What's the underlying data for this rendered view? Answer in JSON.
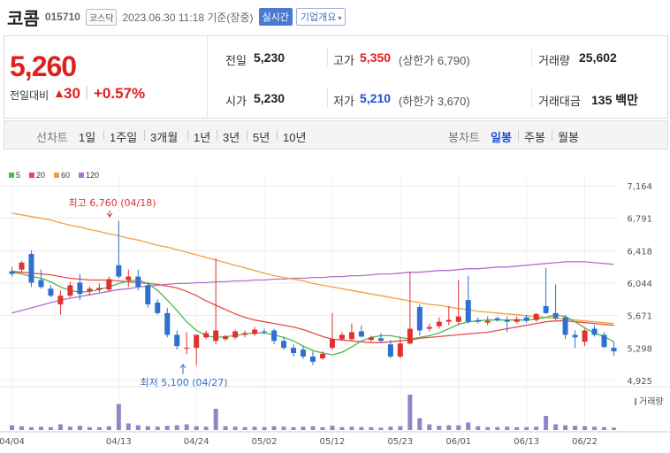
{
  "header": {
    "stock_name": "코콤",
    "stock_code": "015710",
    "market": "코스닥",
    "datetime": "2023.06.30 11:18 기준(장중)",
    "realtime_label": "실시간",
    "company_label": "기업개요"
  },
  "summary": {
    "price": "5,260",
    "change_label": "전일대비",
    "change_arrow": "▲",
    "change_value": "30",
    "change_rate": "+0.57%",
    "prev_close_label": "전일",
    "prev_close": "5,230",
    "open_label": "시가",
    "open": "5,230",
    "high_label": "고가",
    "high": "5,350",
    "upper_limit": "(상한가 6,790)",
    "low_label": "저가",
    "low": "5,210",
    "lower_limit": "(하한가 3,670)",
    "volume_label": "거래량",
    "volume": "25,602",
    "amount_label": "거래대금",
    "amount": "135 백만"
  },
  "tabs": {
    "line_label": "선차트",
    "line_periods": [
      "1일",
      "1주일",
      "3개월",
      "1년",
      "3년",
      "5년",
      "10년"
    ],
    "candle_label": "봉차트",
    "candle_periods": [
      "일봉",
      "주봉",
      "월봉"
    ],
    "active_candle": "일봉"
  },
  "colors": {
    "up": "#e03030",
    "down": "#2f6fd0",
    "ma5": "#4cb84c",
    "ma20": "#e84a4a",
    "ma60": "#f0a040",
    "ma120": "#b070d0",
    "volume": "#8e86c8"
  },
  "chart_data": {
    "type": "candlestick",
    "legend": [
      {
        "name": "5",
        "color": "#4cb84c"
      },
      {
        "name": "20",
        "color": "#e84a4a"
      },
      {
        "name": "60",
        "color": "#f0a040"
      },
      {
        "name": "120",
        "color": "#b070d0"
      }
    ],
    "y_ticks": [
      "7,164",
      "6,791",
      "6,418",
      "6,044",
      "5,671",
      "5,298",
      "4,925"
    ],
    "ylim": [
      4925,
      7164
    ],
    "x_ticks": [
      "04/04",
      "04/13",
      "04/24",
      "05/02",
      "05/12",
      "05/23",
      "06/01",
      "06/13",
      "06/22"
    ],
    "volume_label": "거래량",
    "max_annotation": "최고 6,760 (04/18)",
    "min_annotation": "최저 5,100 (04/27)",
    "candles": [
      {
        "o": 6180,
        "h": 6230,
        "l": 6120,
        "c": 6150
      },
      {
        "o": 6200,
        "h": 6300,
        "l": 6160,
        "c": 6280
      },
      {
        "o": 6380,
        "h": 6420,
        "l": 6000,
        "c": 6050
      },
      {
        "o": 6080,
        "h": 6200,
        "l": 5980,
        "c": 6000
      },
      {
        "o": 5980,
        "h": 6020,
        "l": 5880,
        "c": 5900
      },
      {
        "o": 5800,
        "h": 5960,
        "l": 5680,
        "c": 5900
      },
      {
        "o": 5900,
        "h": 6060,
        "l": 5880,
        "c": 6020
      },
      {
        "o": 6050,
        "h": 6150,
        "l": 5850,
        "c": 5920
      },
      {
        "o": 5950,
        "h": 6010,
        "l": 5900,
        "c": 5980
      },
      {
        "o": 5970,
        "h": 6040,
        "l": 5940,
        "c": 5990
      },
      {
        "o": 5970,
        "h": 6120,
        "l": 5950,
        "c": 6090
      },
      {
        "o": 6250,
        "h": 6760,
        "l": 6100,
        "c": 6120
      },
      {
        "o": 6080,
        "h": 6200,
        "l": 6000,
        "c": 6120
      },
      {
        "o": 6120,
        "h": 6200,
        "l": 5960,
        "c": 6000
      },
      {
        "o": 6020,
        "h": 6060,
        "l": 5760,
        "c": 5800
      },
      {
        "o": 5820,
        "h": 5860,
        "l": 5680,
        "c": 5700
      },
      {
        "o": 5700,
        "h": 5760,
        "l": 5420,
        "c": 5450
      },
      {
        "o": 5450,
        "h": 5500,
        "l": 5280,
        "c": 5320
      },
      {
        "o": 5300,
        "h": 5480,
        "l": 5230,
        "c": 5300
      },
      {
        "o": 5300,
        "h": 5360,
        "l": 5100,
        "c": 5450
      },
      {
        "o": 5420,
        "h": 5500,
        "l": 5400,
        "c": 5470
      },
      {
        "o": 5380,
        "h": 6330,
        "l": 5340,
        "c": 5500
      },
      {
        "o": 5400,
        "h": 5450,
        "l": 5380,
        "c": 5430
      },
      {
        "o": 5420,
        "h": 5510,
        "l": 5400,
        "c": 5490
      },
      {
        "o": 5450,
        "h": 5500,
        "l": 5420,
        "c": 5470
      },
      {
        "o": 5460,
        "h": 5540,
        "l": 5440,
        "c": 5510
      },
      {
        "o": 5490,
        "h": 5520,
        "l": 5460,
        "c": 5480
      },
      {
        "o": 5500,
        "h": 5520,
        "l": 5340,
        "c": 5380
      },
      {
        "o": 5380,
        "h": 5420,
        "l": 5280,
        "c": 5300
      },
      {
        "o": 5300,
        "h": 5340,
        "l": 5200,
        "c": 5240
      },
      {
        "o": 5280,
        "h": 5320,
        "l": 5170,
        "c": 5200
      },
      {
        "o": 5200,
        "h": 5260,
        "l": 5100,
        "c": 5140
      },
      {
        "o": 5180,
        "h": 5260,
        "l": 5160,
        "c": 5230
      },
      {
        "o": 5300,
        "h": 5700,
        "l": 5280,
        "c": 5400
      },
      {
        "o": 5400,
        "h": 5480,
        "l": 5380,
        "c": 5450
      },
      {
        "o": 5400,
        "h": 5580,
        "l": 5380,
        "c": 5480
      },
      {
        "o": 5490,
        "h": 5560,
        "l": 5420,
        "c": 5430
      },
      {
        "o": 5390,
        "h": 5440,
        "l": 5370,
        "c": 5420
      },
      {
        "o": 5410,
        "h": 5470,
        "l": 5370,
        "c": 5380
      },
      {
        "o": 5340,
        "h": 5390,
        "l": 5180,
        "c": 5200
      },
      {
        "o": 5200,
        "h": 5420,
        "l": 5180,
        "c": 5350
      },
      {
        "o": 5350,
        "h": 6180,
        "l": 5340,
        "c": 5520
      },
      {
        "o": 5770,
        "h": 5800,
        "l": 5440,
        "c": 5500
      },
      {
        "o": 5520,
        "h": 5580,
        "l": 5490,
        "c": 5540
      },
      {
        "o": 5550,
        "h": 5650,
        "l": 5520,
        "c": 5600
      },
      {
        "o": 5600,
        "h": 5780,
        "l": 5560,
        "c": 5620
      },
      {
        "o": 5600,
        "h": 6080,
        "l": 5560,
        "c": 5660
      },
      {
        "o": 5850,
        "h": 6130,
        "l": 5580,
        "c": 5600
      },
      {
        "o": 5620,
        "h": 5650,
        "l": 5580,
        "c": 5600
      },
      {
        "o": 5590,
        "h": 5660,
        "l": 5560,
        "c": 5610
      },
      {
        "o": 5640,
        "h": 5660,
        "l": 5600,
        "c": 5620
      },
      {
        "o": 5620,
        "h": 5660,
        "l": 5480,
        "c": 5600
      },
      {
        "o": 5600,
        "h": 5660,
        "l": 5580,
        "c": 5630
      },
      {
        "o": 5650,
        "h": 5680,
        "l": 5590,
        "c": 5610
      },
      {
        "o": 5620,
        "h": 5700,
        "l": 5600,
        "c": 5690
      },
      {
        "o": 5780,
        "h": 6220,
        "l": 5690,
        "c": 5700
      },
      {
        "o": 5700,
        "h": 6030,
        "l": 5620,
        "c": 5640
      },
      {
        "o": 5650,
        "h": 5680,
        "l": 5400,
        "c": 5450
      },
      {
        "o": 5450,
        "h": 5500,
        "l": 5300,
        "c": 5420
      },
      {
        "o": 5370,
        "h": 5520,
        "l": 5320,
        "c": 5500
      },
      {
        "o": 5520,
        "h": 5560,
        "l": 5430,
        "c": 5450
      },
      {
        "o": 5450,
        "h": 5480,
        "l": 5300,
        "c": 5310
      },
      {
        "o": 5300,
        "h": 5370,
        "l": 5210,
        "c": 5260
      }
    ],
    "ma5": [
      6170,
      6150,
      6120,
      6100,
      6060,
      6000,
      5960,
      5940,
      5950,
      5970,
      6000,
      6040,
      6070,
      6080,
      6040,
      5960,
      5850,
      5730,
      5600,
      5500,
      5440,
      5420,
      5430,
      5440,
      5460,
      5470,
      5470,
      5450,
      5420,
      5380,
      5320,
      5270,
      5240,
      5220,
      5250,
      5310,
      5380,
      5420,
      5440,
      5440,
      5420,
      5400,
      5420,
      5440,
      5470,
      5520,
      5570,
      5600,
      5610,
      5620,
      5620,
      5620,
      5620,
      5620,
      5630,
      5650,
      5680,
      5660,
      5600,
      5530,
      5470,
      5430,
      5370
    ],
    "ma20": [
      6180,
      6170,
      6160,
      6150,
      6140,
      6120,
      6100,
      6090,
      6080,
      6080,
      6080,
      6070,
      6060,
      6050,
      6040,
      6030,
      6010,
      5990,
      5950,
      5900,
      5840,
      5790,
      5740,
      5690,
      5650,
      5620,
      5600,
      5580,
      5560,
      5540,
      5510,
      5470,
      5430,
      5400,
      5390,
      5380,
      5370,
      5360,
      5360,
      5370,
      5380,
      5390,
      5410,
      5420,
      5430,
      5440,
      5450,
      5460,
      5470,
      5480,
      5500,
      5520,
      5540,
      5560,
      5580,
      5600,
      5610,
      5610,
      5600,
      5590,
      5580,
      5570,
      5560
    ],
    "ma60": [
      6850,
      6830,
      6810,
      6790,
      6770,
      6740,
      6710,
      6690,
      6660,
      6640,
      6610,
      6590,
      6560,
      6540,
      6510,
      6480,
      6460,
      6430,
      6400,
      6370,
      6340,
      6310,
      6280,
      6250,
      6220,
      6190,
      6160,
      6130,
      6110,
      6090,
      6070,
      6040,
      6020,
      6000,
      5980,
      5960,
      5940,
      5920,
      5900,
      5880,
      5860,
      5840,
      5820,
      5800,
      5790,
      5770,
      5750,
      5740,
      5720,
      5710,
      5700,
      5690,
      5680,
      5670,
      5660,
      5650,
      5640,
      5630,
      5620,
      5610,
      5600,
      5590,
      5580
    ],
    "ma120": [
      5700,
      5730,
      5760,
      5790,
      5820,
      5850,
      5870,
      5890,
      5910,
      5930,
      5950,
      5970,
      5980,
      6000,
      6010,
      6020,
      6030,
      6040,
      6040,
      6050,
      6050,
      6060,
      6060,
      6070,
      6070,
      6080,
      6080,
      6090,
      6090,
      6100,
      6100,
      6110,
      6110,
      6120,
      6120,
      6130,
      6130,
      6140,
      6150,
      6150,
      6160,
      6170,
      6170,
      6180,
      6190,
      6190,
      6200,
      6210,
      6210,
      6220,
      6230,
      6230,
      6240,
      6250,
      6260,
      6270,
      6280,
      6290,
      6290,
      6290,
      6280,
      6270,
      6260
    ],
    "volumes": [
      10,
      8,
      6,
      7,
      6,
      12,
      7,
      9,
      6,
      6,
      8,
      55,
      14,
      10,
      8,
      7,
      9,
      10,
      12,
      8,
      7,
      45,
      8,
      7,
      6,
      7,
      6,
      8,
      7,
      6,
      7,
      8,
      6,
      9,
      6,
      7,
      6,
      6,
      5,
      7,
      8,
      75,
      25,
      12,
      9,
      10,
      10,
      16,
      8,
      6,
      6,
      7,
      6,
      6,
      7,
      30,
      12,
      10,
      9,
      8,
      7,
      6,
      5
    ]
  }
}
